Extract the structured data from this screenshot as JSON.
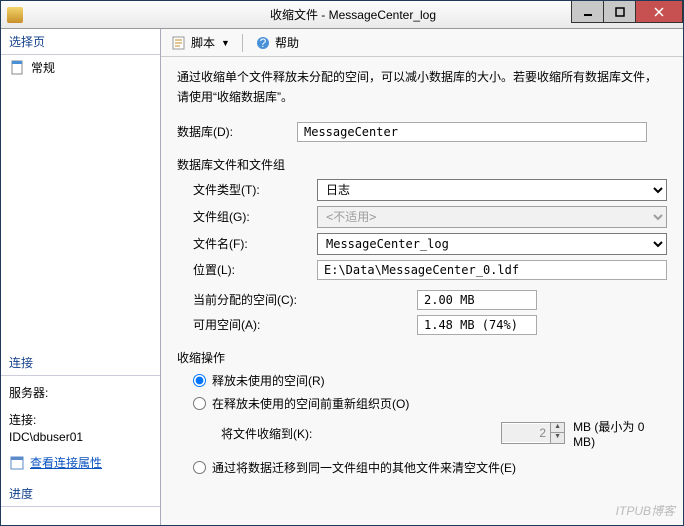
{
  "window": {
    "title": "收缩文件 - MessageCenter_log"
  },
  "sidebar": {
    "select_page": "选择页",
    "general": "常规",
    "connection": "连接",
    "server_label": "服务器:",
    "server_value": "",
    "conn_label": "连接:",
    "conn_value": "IDC\\dbuser01",
    "view_props": "查看连接属性",
    "progress": "进度"
  },
  "toolbar": {
    "script": "脚本",
    "help": "帮助"
  },
  "main": {
    "description": "通过收缩单个文件释放未分配的空间，可以减小数据库的大小。若要收缩所有数据库文件，请使用“收缩数据库”。",
    "db_label": "数据库(D):",
    "db_value": "MessageCenter",
    "group_title": "数据库文件和文件组",
    "filetype_label": "文件类型(T):",
    "filetype_value": "日志",
    "filegroup_label": "文件组(G):",
    "filegroup_value": "<不适用>",
    "filename_label": "文件名(F):",
    "filename_value": "MessageCenter_log",
    "location_label": "位置(L):",
    "location_value": "E:\\Data\\MessageCenter_0.ldf",
    "allocated_label": "当前分配的空间(C):",
    "allocated_value": "2.00 MB",
    "avail_label": "可用空间(A):",
    "avail_value": "1.48 MB (74%)",
    "shrink_title": "收缩操作",
    "opt_release": "释放未使用的空间(R)",
    "opt_reorg": "在释放未使用的空间前重新组织页(O)",
    "shrink_to_label": "将文件收缩到(K):",
    "shrink_to_value": "2",
    "shrink_to_unit": "MB (最小为 0 MB)",
    "opt_migrate": "通过将数据迁移到同一文件组中的其他文件来清空文件(E)"
  },
  "watermark": "ITPUB博客"
}
